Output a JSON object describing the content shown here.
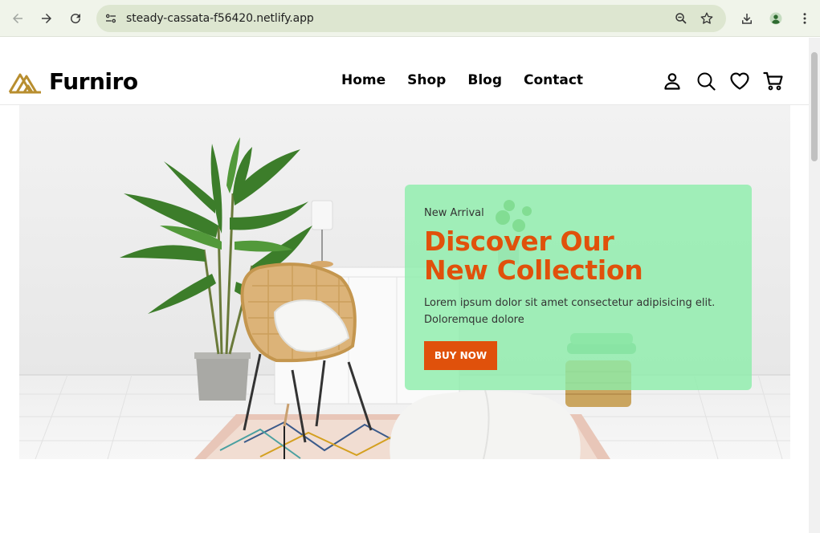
{
  "browser": {
    "url": "steady-cassata-f56420.netlify.app",
    "icons": [
      "back-icon",
      "forward-icon",
      "reload-icon",
      "site-info-icon",
      "zoom-icon",
      "bookmark-star-icon",
      "download-icon",
      "profile-icon",
      "menu-icon"
    ]
  },
  "site": {
    "brand": "Furniro",
    "nav": [
      "Home",
      "Shop",
      "Blog",
      "Contact"
    ],
    "header_icons": [
      "account-icon",
      "search-icon",
      "wishlist-heart-icon",
      "cart-icon"
    ]
  },
  "hero": {
    "subtitle": "New Arrival",
    "title_line1": "Discover Our",
    "title_line2": "New Collection",
    "description": "Lorem ipsum dolor sit amet consectetur adipisicing elit. Doloremque dolore",
    "button": "BUY NOW"
  },
  "colors": {
    "accent": "#e0510b",
    "card": "#8ceeaa",
    "logo": "#b88e2f",
    "chrome": "#f0f4ea"
  }
}
